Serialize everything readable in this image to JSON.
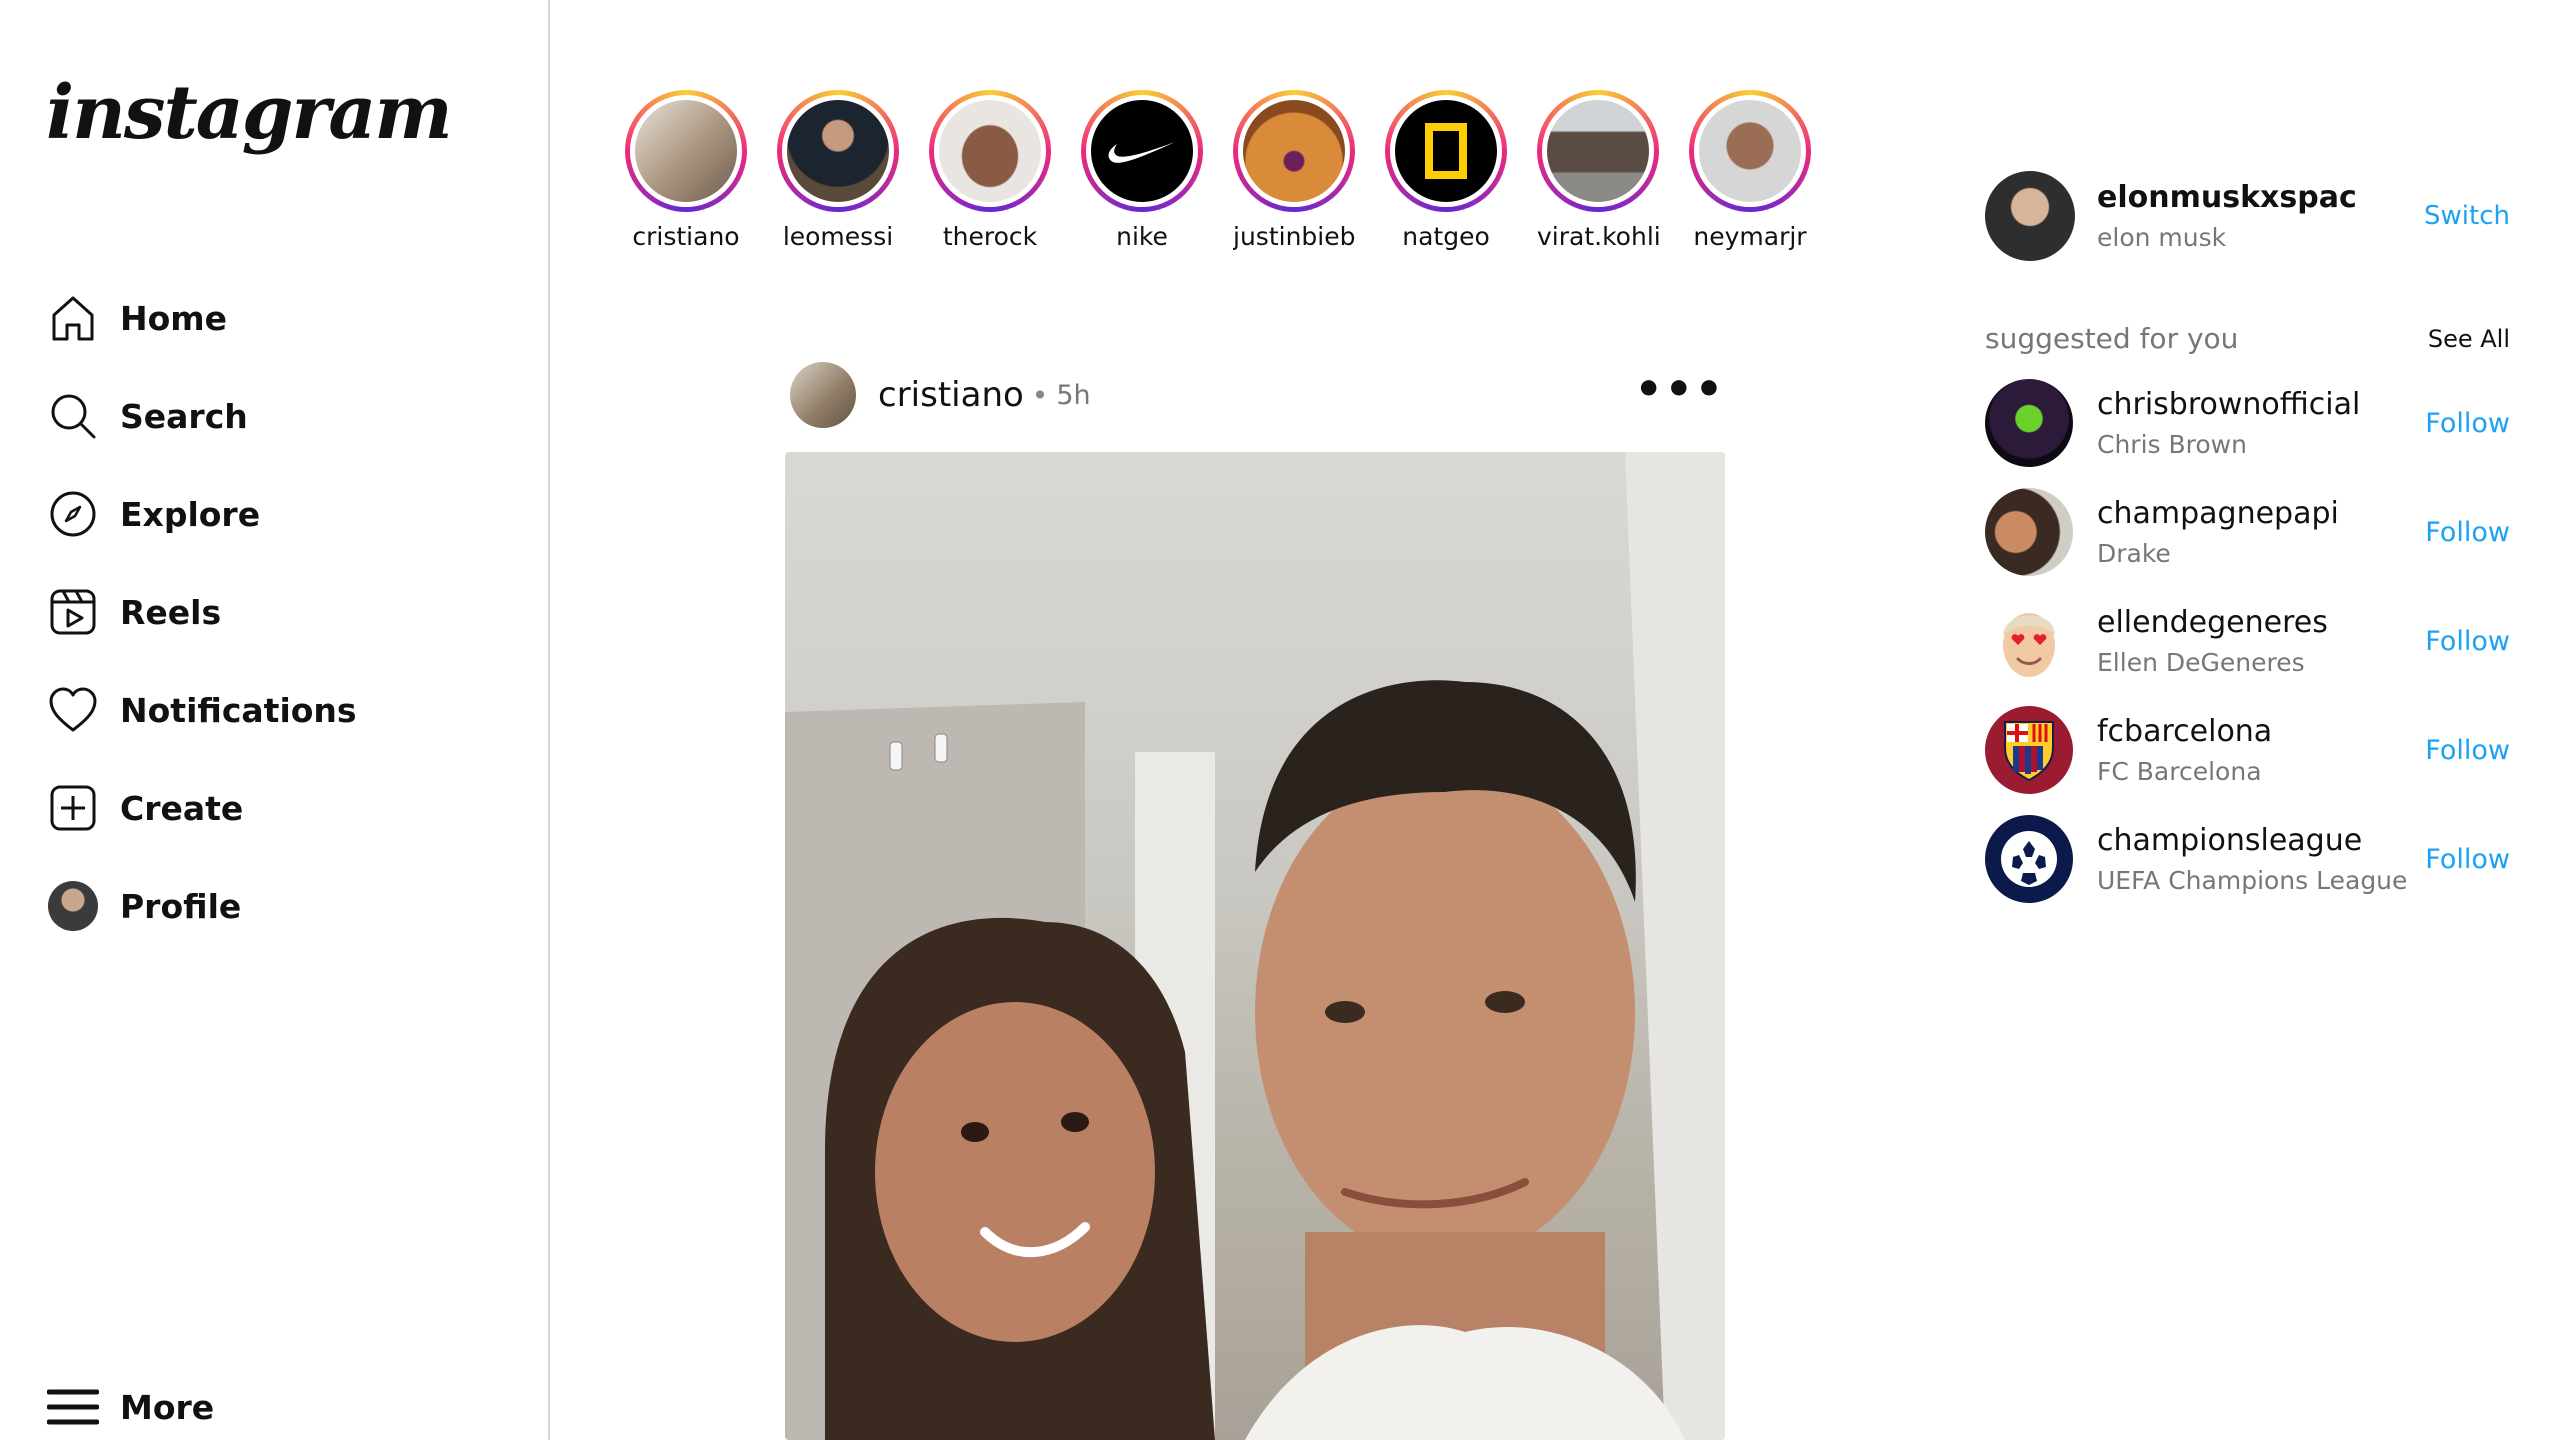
{
  "brand": {
    "logo_text": "instagram"
  },
  "nav": {
    "items": [
      {
        "label": "Home",
        "icon": "home-icon"
      },
      {
        "label": "Search",
        "icon": "search-icon"
      },
      {
        "label": "Explore",
        "icon": "compass-icon"
      },
      {
        "label": "Reels",
        "icon": "reels-icon"
      },
      {
        "label": "Notifications",
        "icon": "heart-icon"
      },
      {
        "label": "Create",
        "icon": "plus-square-icon"
      },
      {
        "label": "Profile",
        "icon": "avatar"
      }
    ],
    "more_label": "More"
  },
  "stories": [
    {
      "user": "cristiano"
    },
    {
      "user": "leomessi"
    },
    {
      "user": "therock"
    },
    {
      "user": "nike"
    },
    {
      "user": "justinbieb..."
    },
    {
      "user": "natgeo"
    },
    {
      "user": "virat.kohli"
    },
    {
      "user": "neymarjr"
    }
  ],
  "post": {
    "user": "cristiano",
    "separator": "•",
    "time": "5h",
    "menu": "•••"
  },
  "account": {
    "username": "elonmuskxspac",
    "name": "elon musk",
    "switch_label": "Switch"
  },
  "suggestions": {
    "title": "suggested for you",
    "see_all": "See All",
    "items": [
      {
        "username": "chrisbrownofficial",
        "name": "Chris Brown",
        "action": "Follow"
      },
      {
        "username": "champagnepapi",
        "name": "Drake",
        "action": "Follow"
      },
      {
        "username": "ellendegeneres",
        "name": "Ellen DeGeneres",
        "action": "Follow"
      },
      {
        "username": "fcbarcelona",
        "name": "FC Barcelona",
        "action": "Follow"
      },
      {
        "username": "championsleague",
        "name": "UEFA Champions League",
        "action": "Follow"
      }
    ]
  },
  "colors": {
    "link": "#1da1f2",
    "border": "#d6d6d6",
    "muted": "#777777"
  }
}
